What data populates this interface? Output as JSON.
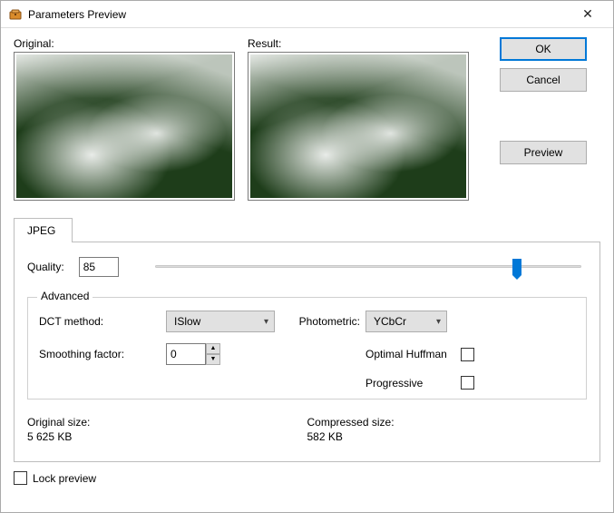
{
  "window": {
    "title": "Parameters Preview"
  },
  "previews": {
    "original_label": "Original:",
    "result_label": "Result:"
  },
  "buttons": {
    "ok": "OK",
    "cancel": "Cancel",
    "preview": "Preview"
  },
  "tabs": {
    "jpeg": "JPEG"
  },
  "quality": {
    "label": "Quality:",
    "value": "85",
    "slider_percent": 85
  },
  "advanced": {
    "legend": "Advanced",
    "dct_label": "DCT method:",
    "dct_value": "ISlow",
    "photometric_label": "Photometric:",
    "photometric_value": "YCbCr",
    "smoothing_label": "Smoothing factor:",
    "smoothing_value": "0",
    "optimal_huffman_label": "Optimal Huffman",
    "optimal_huffman_checked": false,
    "progressive_label": "Progressive",
    "progressive_checked": false
  },
  "sizes": {
    "original_label": "Original size:",
    "original_value": "5 625 KB",
    "compressed_label": "Compressed size:",
    "compressed_value": "582 KB"
  },
  "footer": {
    "lock_preview_label": "Lock preview",
    "lock_preview_checked": false
  }
}
